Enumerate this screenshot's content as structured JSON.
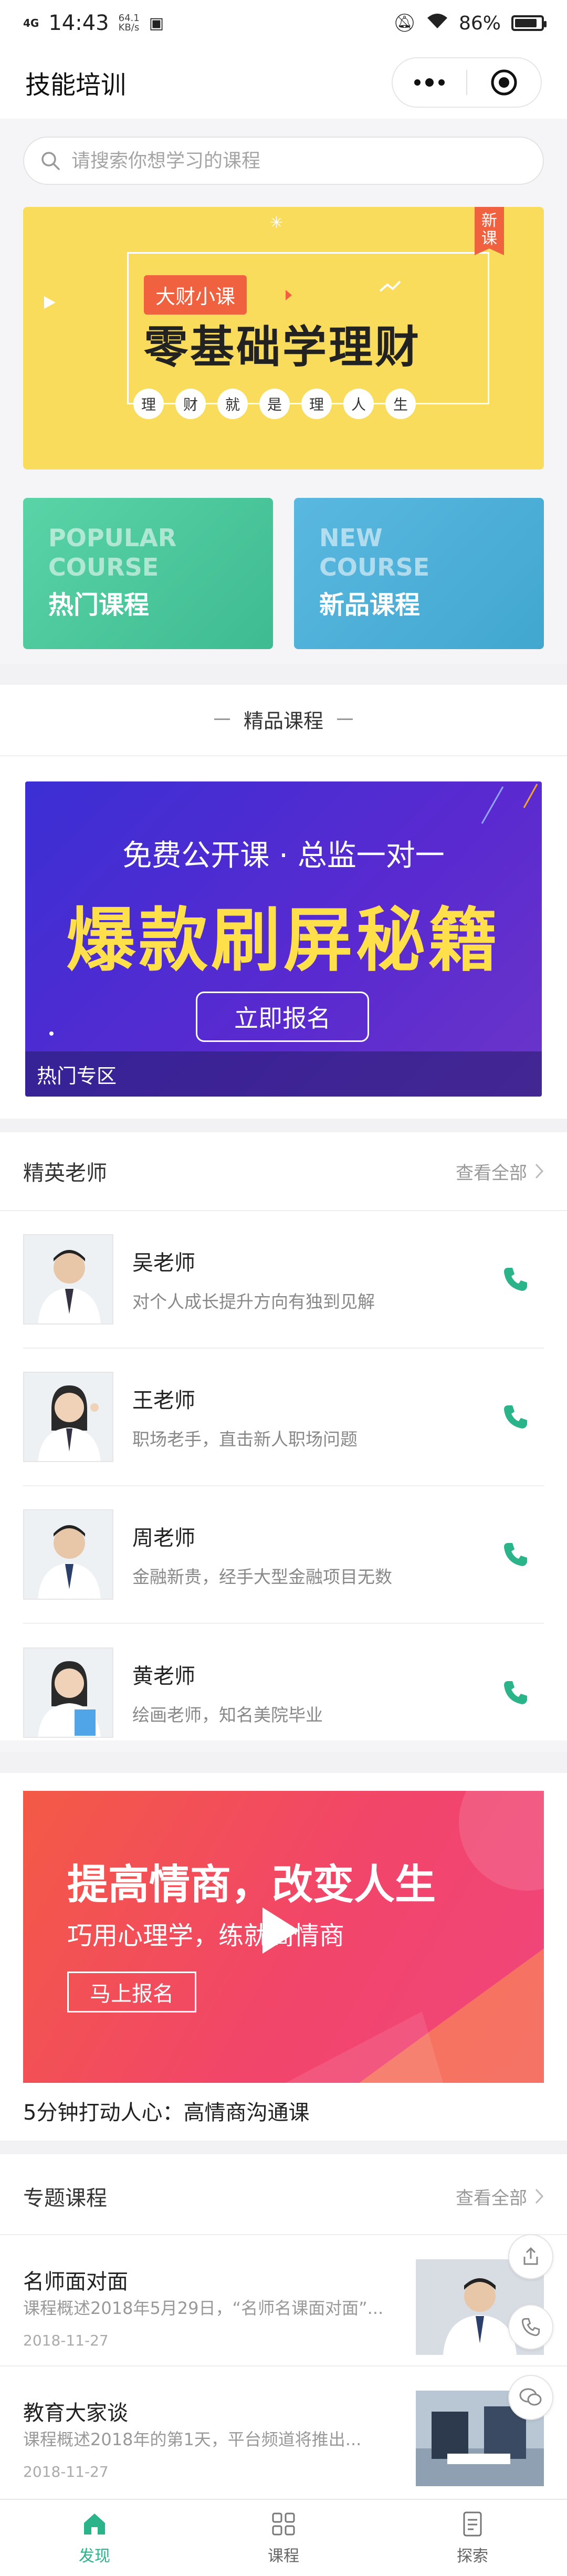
{
  "status_bar": {
    "network": "4G",
    "time": "14:43",
    "speed_value": "64.1",
    "speed_unit": "KB/s",
    "battery": "86%",
    "battery_level": 0.86
  },
  "nav": {
    "title": "技能培训"
  },
  "search": {
    "placeholder": "请搜索你想学习的课程"
  },
  "banner_top": {
    "tag": "大财小课",
    "headline": "零基础学理财",
    "chars": [
      "理",
      "财",
      "就",
      "是",
      "理",
      "人",
      "生"
    ],
    "badge": "新课"
  },
  "cards": [
    {
      "en_line1": "POPULAR",
      "en_line2": "COURSE",
      "cn": "热门课程"
    },
    {
      "en_line1": "NEW",
      "en_line2": "COURSE",
      "cn": "新品课程"
    }
  ],
  "featured": {
    "section_title": "精品课程",
    "sub": "免费公开课 · 总监一对一",
    "main": "爆款刷屏秘籍",
    "button": "立即报名",
    "bar_label": "热门专区"
  },
  "teachers": {
    "title": "精英老师",
    "more": "查看全部",
    "items": [
      {
        "name": "吴老师",
        "desc": "对个人成长提升方向有独到见解"
      },
      {
        "name": "王老师",
        "desc": "职场老手，直击新人职场问题"
      },
      {
        "name": "周老师",
        "desc": "金融新贵，经手大型金融项目无数"
      },
      {
        "name": "黄老师",
        "desc": "绘画老师，知名美院毕业"
      }
    ]
  },
  "video": {
    "title": "提高情商，改变人生",
    "sub": "巧用心理学，练就高情商",
    "button": "马上报名",
    "caption": "5分钟打动人心：高情商沟通课"
  },
  "topics": {
    "title": "专题课程",
    "more": "查看全部",
    "items": [
      {
        "title": "名师面对面",
        "desc": "课程概述2018年5月29日，“名师名课面对面”...",
        "date": "2018-11-27"
      },
      {
        "title": "教育大家谈",
        "desc": "课程概述2018年的第1天，平台频道将推出...",
        "date": "2018-11-27"
      }
    ]
  },
  "tabbar": [
    {
      "label": "发现",
      "icon": "home-icon",
      "active": true
    },
    {
      "label": "课程",
      "icon": "grid-icon",
      "active": false
    },
    {
      "label": "探索",
      "icon": "document-icon",
      "active": false
    }
  ],
  "colors": {
    "accent": "#2bb48a",
    "banner_yellow": "#f9dc5c",
    "popular": "#4cc79c",
    "new": "#4fb0d9"
  }
}
